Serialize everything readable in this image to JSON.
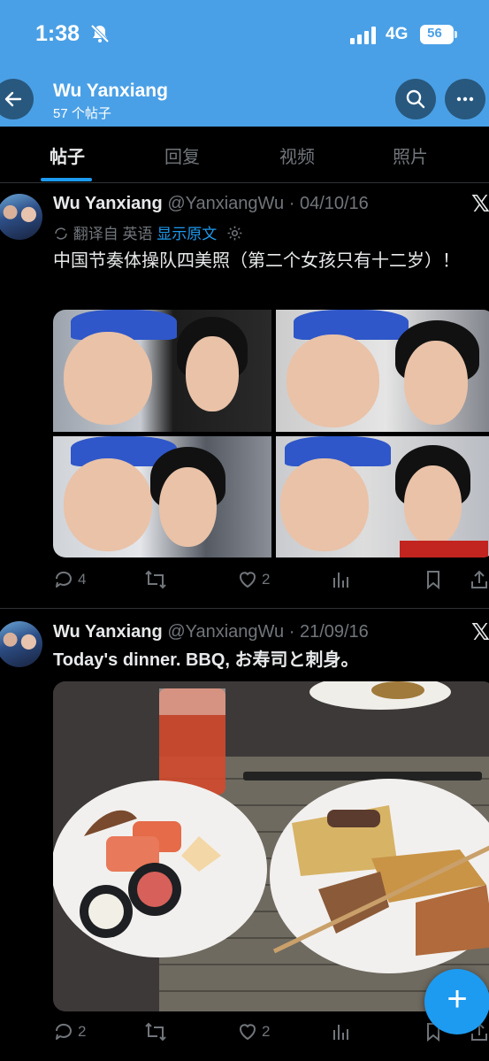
{
  "status_bar": {
    "time": "1:38",
    "network": "4G",
    "battery": "56"
  },
  "header": {
    "name": "Wu Yanxiang",
    "post_count": "57 个帖子"
  },
  "tabs": [
    {
      "label": "帖子",
      "active": true
    },
    {
      "label": "回复",
      "active": false
    },
    {
      "label": "视频",
      "active": false
    },
    {
      "label": "照片",
      "active": false
    }
  ],
  "posts": [
    {
      "name": "Wu Yanxiang",
      "meta": "@YanxiangWu · 04/10/16",
      "translation": {
        "label": "翻译自 英语",
        "action": "显示原文"
      },
      "text": "中国节奏体操队四美照（第二个女孩只有十二岁）！",
      "replies": "4",
      "likes": "2"
    },
    {
      "name": "Wu Yanxiang",
      "meta": "@YanxiangWu · 21/09/16",
      "text": "Today's dinner. BBQ, お寿司と刺身。",
      "replies": "2",
      "likes": "2"
    }
  ],
  "icons": [
    "back-arrow-icon",
    "search-icon",
    "more-icon",
    "x-logo-icon",
    "reply-icon",
    "repost-icon",
    "like-icon",
    "views-icon",
    "bookmark-icon",
    "share-icon",
    "plus-icon"
  ],
  "colors": {
    "header_bg": "#4aa0e6",
    "accent": "#1d9bf0",
    "muted": "#71767b",
    "bg": "#000000"
  }
}
